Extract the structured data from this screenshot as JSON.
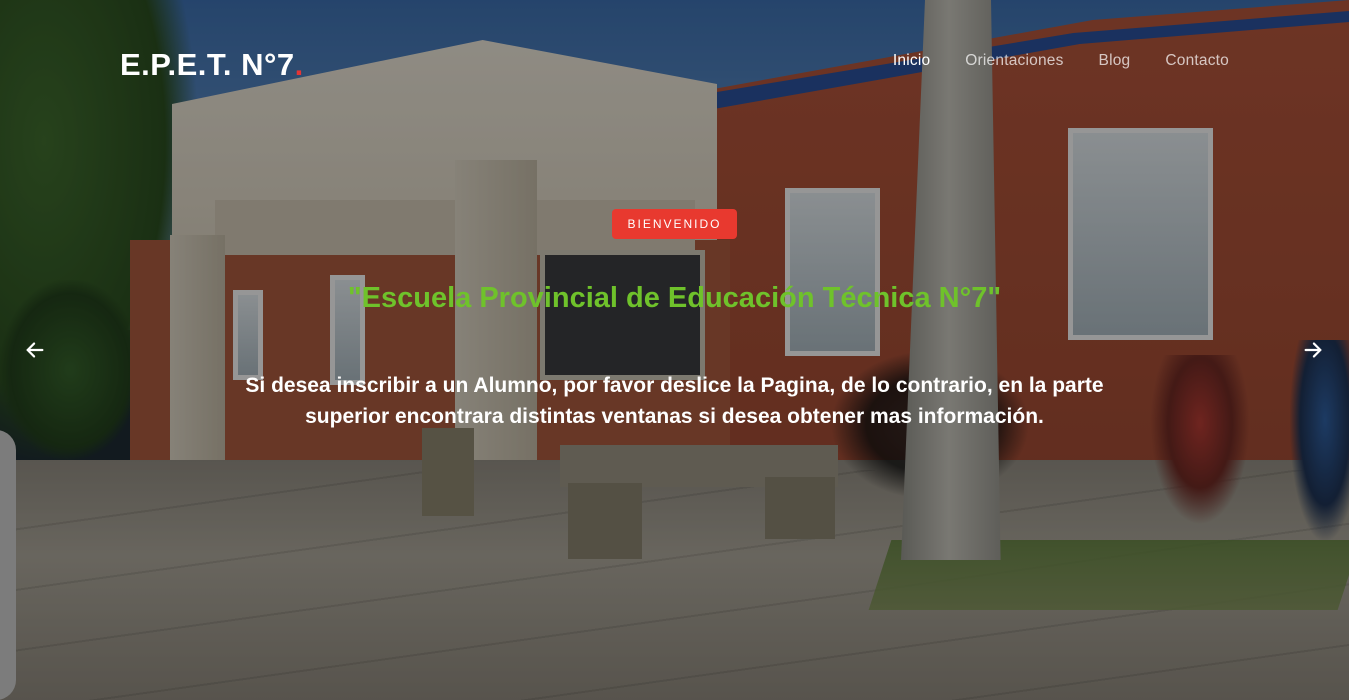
{
  "navbar": {
    "brand": "E.P.E.T. N°7",
    "brand_dot": ".",
    "links": [
      {
        "label": "Inicio",
        "active": true
      },
      {
        "label": "Orientaciones",
        "active": false
      },
      {
        "label": "Blog",
        "active": false
      },
      {
        "label": "Contacto",
        "active": false
      }
    ]
  },
  "hero": {
    "badge": "BIENVENIDO",
    "headline": "\"Escuela Provincial de Educación Técnica N°7\"",
    "subtext": "Si desea inscribir a un Alumno, por favor deslice la Pagina, de lo contrario, en la parte superior encontrara distintas ventanas si desea obtener mas información."
  },
  "carousel": {
    "prev_icon": "arrow-left-icon",
    "next_icon": "arrow-right-icon"
  },
  "colors": {
    "accent_red": "#e8392f",
    "headline_green": "#6fc22b",
    "brand_dot": "#e73434"
  }
}
